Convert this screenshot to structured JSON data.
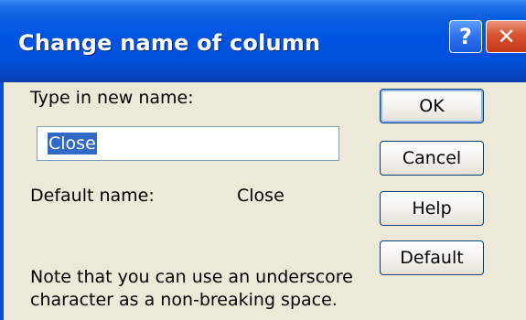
{
  "window": {
    "title": "Change name of column",
    "help_glyph": "?",
    "close_glyph": "✕"
  },
  "form": {
    "new_name_label": "Type in new name:",
    "new_name_value": "Close",
    "default_name_label": "Default name:",
    "default_name_value": "Close"
  },
  "buttons": {
    "ok": "OK",
    "cancel": "Cancel",
    "help": "Help",
    "default": "Default"
  },
  "note": {
    "line1": "Note that you can use an underscore",
    "line2": "character as a non-breaking space."
  },
  "colors": {
    "titlebar": "#0054E3",
    "dialog_bg": "#ECE9D8",
    "selection": "#316AC5",
    "close_button": "#D8532F"
  },
  "icons": {
    "help": "help-question-icon",
    "close": "close-x-icon"
  }
}
